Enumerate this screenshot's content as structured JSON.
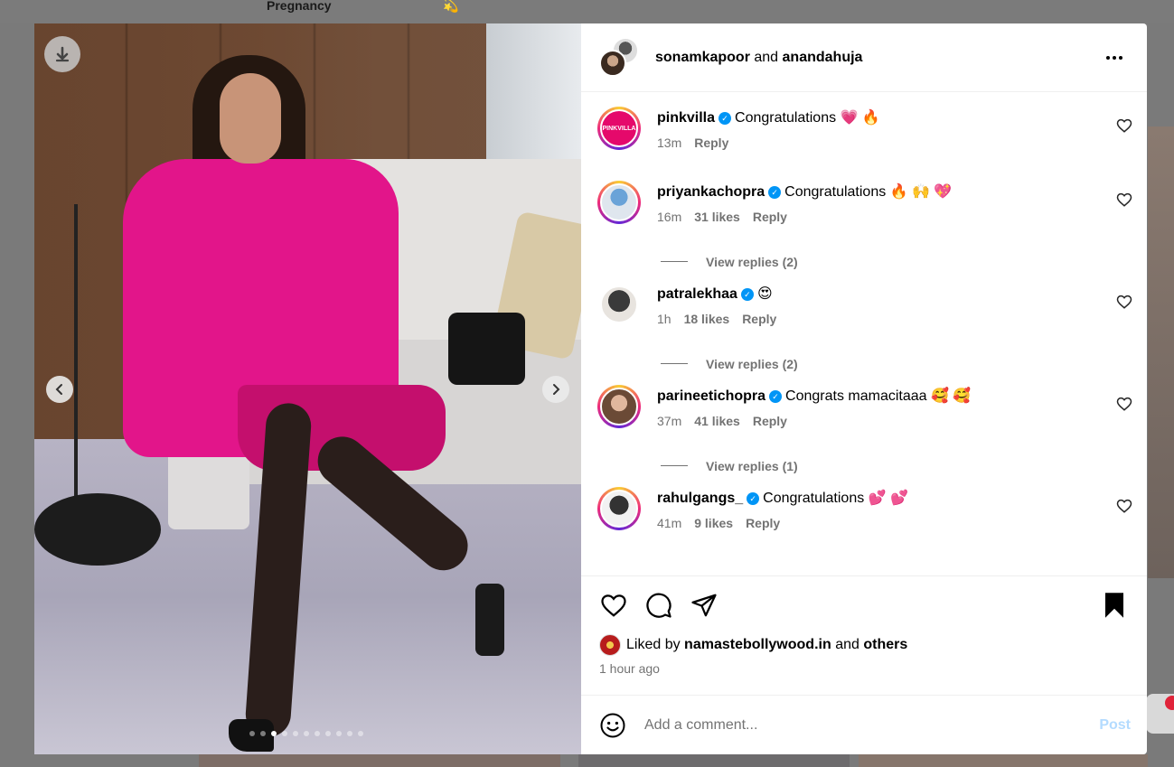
{
  "background": {
    "topic_label": "Pregnancy",
    "topic_emoji": "💫"
  },
  "post": {
    "header": {
      "user1": "sonamkapoor",
      "joiner": "and",
      "user2": "anandahuja"
    },
    "carousel": {
      "total_slides": 11,
      "active_slide": 3
    },
    "comments": [
      {
        "user": "pinkvilla",
        "avatar_text": "PINKVILLA",
        "text": "Congratulations 💗 🔥",
        "time": "13m",
        "likes": "",
        "reply": "Reply",
        "view_replies": ""
      },
      {
        "user": "priyankachopra",
        "avatar_text": "",
        "text": "Congratulations 🔥 🙌 💖",
        "time": "16m",
        "likes": "31 likes",
        "reply": "Reply",
        "view_replies": "View replies (2)"
      },
      {
        "user": "patralekhaa",
        "avatar_text": "",
        "text": "😍",
        "time": "1h",
        "likes": "18 likes",
        "reply": "Reply",
        "view_replies": "View replies (2)"
      },
      {
        "user": "parineetichopra",
        "avatar_text": "",
        "text": "Congrats mamacitaaa 🥰 🥰",
        "time": "37m",
        "likes": "41 likes",
        "reply": "Reply",
        "view_replies": "View replies (1)"
      },
      {
        "user": "rahulgangs_",
        "avatar_text": "",
        "text": "Congratulations 💕 💕",
        "time": "41m",
        "likes": "9 likes",
        "reply": "Reply",
        "view_replies": ""
      }
    ],
    "likes": {
      "prefix": "Liked by",
      "user": "namastebollywood.in",
      "joiner": "and",
      "others": "others"
    },
    "time_ago": "1 hour ago",
    "add_comment": {
      "placeholder": "Add a comment...",
      "post_label": "Post"
    }
  },
  "colors": {
    "accent": "#0095f6",
    "post_disabled": "#b3dbff",
    "coat": "#e2158a"
  }
}
